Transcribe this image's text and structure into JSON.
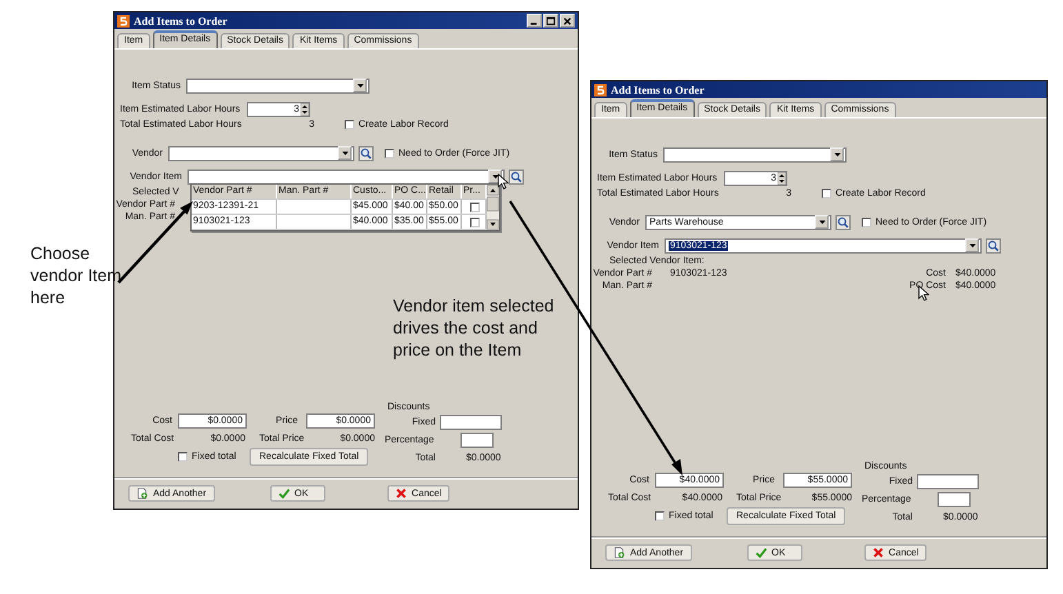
{
  "windows": [
    {
      "title": "Add Items to Order",
      "window_buttons": true,
      "tabs": [
        {
          "label": "Item",
          "selected": false
        },
        {
          "label": "Item Details",
          "selected": true
        },
        {
          "label": "Stock Details",
          "selected": false
        },
        {
          "label": "Kit Items",
          "selected": false
        },
        {
          "label": "Commissions",
          "selected": false
        }
      ],
      "item_status": {
        "label": "Item Status"
      },
      "labor_hours": {
        "label": "Item Estimated Labor Hours",
        "value": "3"
      },
      "total_labor_hours": {
        "label": "Total Estimated Labor Hours",
        "value": "3"
      },
      "create_labor_record": {
        "label": "Create Labor Record",
        "checked": false
      },
      "vendor": {
        "label": "Vendor"
      },
      "need_to_order": {
        "label": "Need to Order (Force JIT)",
        "checked": false
      },
      "vendor_item": {
        "label": "Vendor Item"
      },
      "vendor_item_dropdown": {
        "columns": [
          "Vendor Part #",
          "Man. Part #",
          "Custo...",
          "PO C...",
          "Retail",
          "Pr..."
        ],
        "rows": [
          {
            "cells": [
              "9203-12391-21",
              "",
              "$45.000",
              "$40.00",
              "$50.00"
            ],
            "checked": false
          },
          {
            "cells": [
              "9103021-123",
              "",
              "$40.000",
              "$35.00",
              "$55.00"
            ],
            "checked": false
          }
        ]
      },
      "selected_vendor_item": {
        "heading": "Selected V",
        "vendor_part_label": "Vendor Part #",
        "man_part_label": "Man. Part #"
      },
      "pricing": {
        "cost_label": "Cost",
        "cost": "$0.0000",
        "price_label": "Price",
        "price": "$0.0000",
        "total_cost_label": "Total Cost",
        "total_cost": "$0.0000",
        "total_price_label": "Total Price",
        "total_price": "$0.0000",
        "fixed_total": {
          "label": "Fixed total",
          "checked": false
        },
        "recalculate_button": "Recalculate Fixed Total"
      },
      "discounts": {
        "heading": "Discounts",
        "fixed_label": "Fixed",
        "percentage_label": "Percentage",
        "total_label": "Total",
        "total": "$0.0000"
      },
      "buttons": [
        {
          "label": "Add Another",
          "kind": "add"
        },
        {
          "label": "OK",
          "kind": "ok"
        },
        {
          "label": "Cancel",
          "kind": "cancel"
        }
      ]
    },
    {
      "title": "Add Items to Order",
      "window_buttons": false,
      "tabs": [
        {
          "label": "Item",
          "selected": false
        },
        {
          "label": "Item Details",
          "selected": true
        },
        {
          "label": "Stock Details",
          "selected": false
        },
        {
          "label": "Kit Items",
          "selected": false
        },
        {
          "label": "Commissions",
          "selected": false
        }
      ],
      "item_status": {
        "label": "Item Status"
      },
      "labor_hours": {
        "label": "Item Estimated Labor Hours",
        "value": "3"
      },
      "total_labor_hours": {
        "label": "Total Estimated Labor Hours",
        "value": "3"
      },
      "create_labor_record": {
        "label": "Create Labor Record",
        "checked": false
      },
      "vendor": {
        "label": "Vendor",
        "value": "Parts Warehouse"
      },
      "need_to_order": {
        "label": "Need to Order (Force JIT)",
        "checked": false
      },
      "vendor_item": {
        "label": "Vendor Item",
        "value": "9103021-123",
        "highlighted": true
      },
      "selected_vendor_item": {
        "heading": "Selected Vendor Item:",
        "vendor_part_label": "Vendor Part #",
        "vendor_part": "9103021-123",
        "man_part_label": "Man. Part #",
        "cost_label": "Cost",
        "cost": "$40.0000",
        "po_cost_label": "PO Cost",
        "po_cost": "$40.0000"
      },
      "pricing": {
        "cost_label": "Cost",
        "cost": "$40.0000",
        "price_label": "Price",
        "price": "$55.0000",
        "total_cost_label": "Total Cost",
        "total_cost": "$40.0000",
        "total_price_label": "Total Price",
        "total_price": "$55.0000",
        "fixed_total": {
          "label": "Fixed total",
          "checked": false
        },
        "recalculate_button": "Recalculate Fixed Total"
      },
      "discounts": {
        "heading": "Discounts",
        "fixed_label": "Fixed",
        "percentage_label": "Percentage",
        "total_label": "Total",
        "total": "$0.0000"
      },
      "buttons": [
        {
          "label": "Add Another",
          "kind": "add"
        },
        {
          "label": "OK",
          "kind": "ok"
        },
        {
          "label": "Cancel",
          "kind": "cancel"
        }
      ]
    }
  ],
  "annotations": [
    {
      "text": "Choose vendor Item here"
    },
    {
      "text": "Vendor item selected drives the cost and price on the Item"
    }
  ]
}
